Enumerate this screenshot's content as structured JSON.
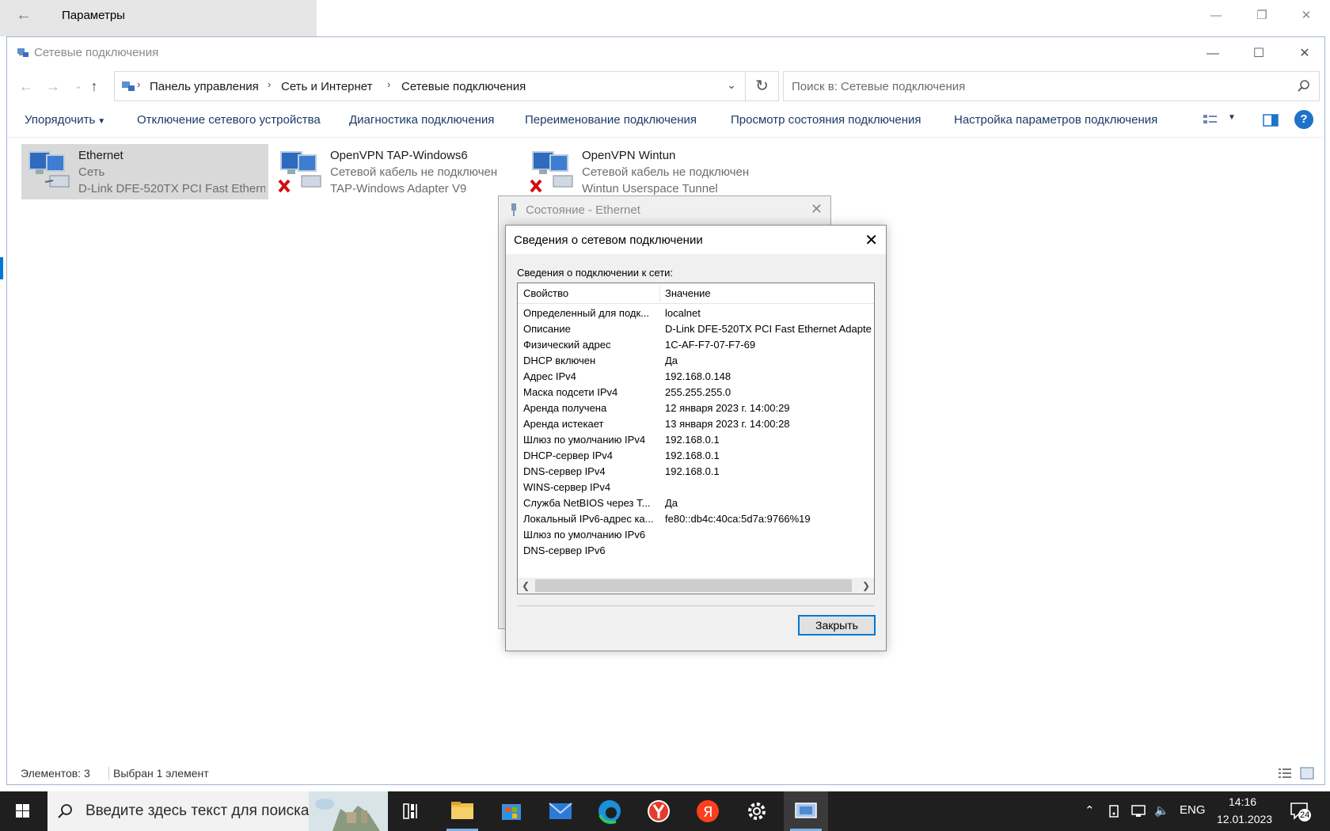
{
  "settings": {
    "title": "Параметры"
  },
  "explorer": {
    "title": "Сетевые подключения",
    "breadcrumbs": [
      "Панель управления",
      "Сеть и Интернет",
      "Сетевые подключения"
    ],
    "search_placeholder": "Поиск в: Сетевые подключения",
    "commands": {
      "organize": "Упорядочить",
      "disable": "Отключение сетевого устройства",
      "diagnose": "Диагностика подключения",
      "rename": "Переименование подключения",
      "view_status": "Просмотр состояния подключения",
      "settings": "Настройка параметров подключения"
    },
    "connections": [
      {
        "name": "Ethernet",
        "status": "Сеть",
        "device": "D-Link DFE-520TX PCI Fast Ethern...",
        "selected": true,
        "disconnected": false
      },
      {
        "name": "OpenVPN TAP-Windows6",
        "status": "Сетевой кабель не подключен",
        "device": "TAP-Windows Adapter V9",
        "selected": false,
        "disconnected": true
      },
      {
        "name": "OpenVPN Wintun",
        "status": "Сетевой кабель не подключен",
        "device": "Wintun Userspace Tunnel",
        "selected": false,
        "disconnected": true
      }
    ],
    "statusbar": {
      "count": "Элементов: 3",
      "selected": "Выбран 1 элемент"
    }
  },
  "status_dialog": {
    "title": "Состояние - Ethernet"
  },
  "details_dialog": {
    "title": "Сведения о сетевом подключении",
    "list_label": "Сведения о подключении к сети:",
    "col_property": "Свойство",
    "col_value": "Значение",
    "rows": [
      {
        "prop": "Определенный для подк...",
        "val": "localnet"
      },
      {
        "prop": "Описание",
        "val": "D-Link DFE-520TX PCI Fast Ethernet Adapte"
      },
      {
        "prop": "Физический адрес",
        "val": "1C-AF-F7-07-F7-69"
      },
      {
        "prop": "DHCP включен",
        "val": "Да"
      },
      {
        "prop": "Адрес IPv4",
        "val": "192.168.0.148"
      },
      {
        "prop": "Маска подсети IPv4",
        "val": "255.255.255.0"
      },
      {
        "prop": "Аренда получена",
        "val": "12 января 2023 г. 14:00:29"
      },
      {
        "prop": "Аренда истекает",
        "val": "13 января 2023 г. 14:00:28"
      },
      {
        "prop": "Шлюз по умолчанию IPv4",
        "val": "192.168.0.1"
      },
      {
        "prop": "DHCP-сервер IPv4",
        "val": "192.168.0.1"
      },
      {
        "prop": "DNS-сервер IPv4",
        "val": "192.168.0.1"
      },
      {
        "prop": "WINS-сервер IPv4",
        "val": ""
      },
      {
        "prop": "Служба NetBIOS через Т...",
        "val": "Да"
      },
      {
        "prop": "Локальный IPv6-адрес ка...",
        "val": "fe80::db4c:40ca:5d7a:9766%19"
      },
      {
        "prop": "Шлюз по умолчанию IPv6",
        "val": ""
      },
      {
        "prop": "DNS-сервер IPv6",
        "val": ""
      }
    ],
    "close_label": "Закрыть"
  },
  "taskbar": {
    "search_placeholder": "Введите здесь текст для поиска",
    "lang": "ENG",
    "time": "14:16",
    "date": "12.01.2023",
    "notifications": "24"
  },
  "colors": {
    "accent": "#0078d4",
    "cmd_text": "#1a3a6a",
    "taskbar": "#1f1f1f"
  }
}
